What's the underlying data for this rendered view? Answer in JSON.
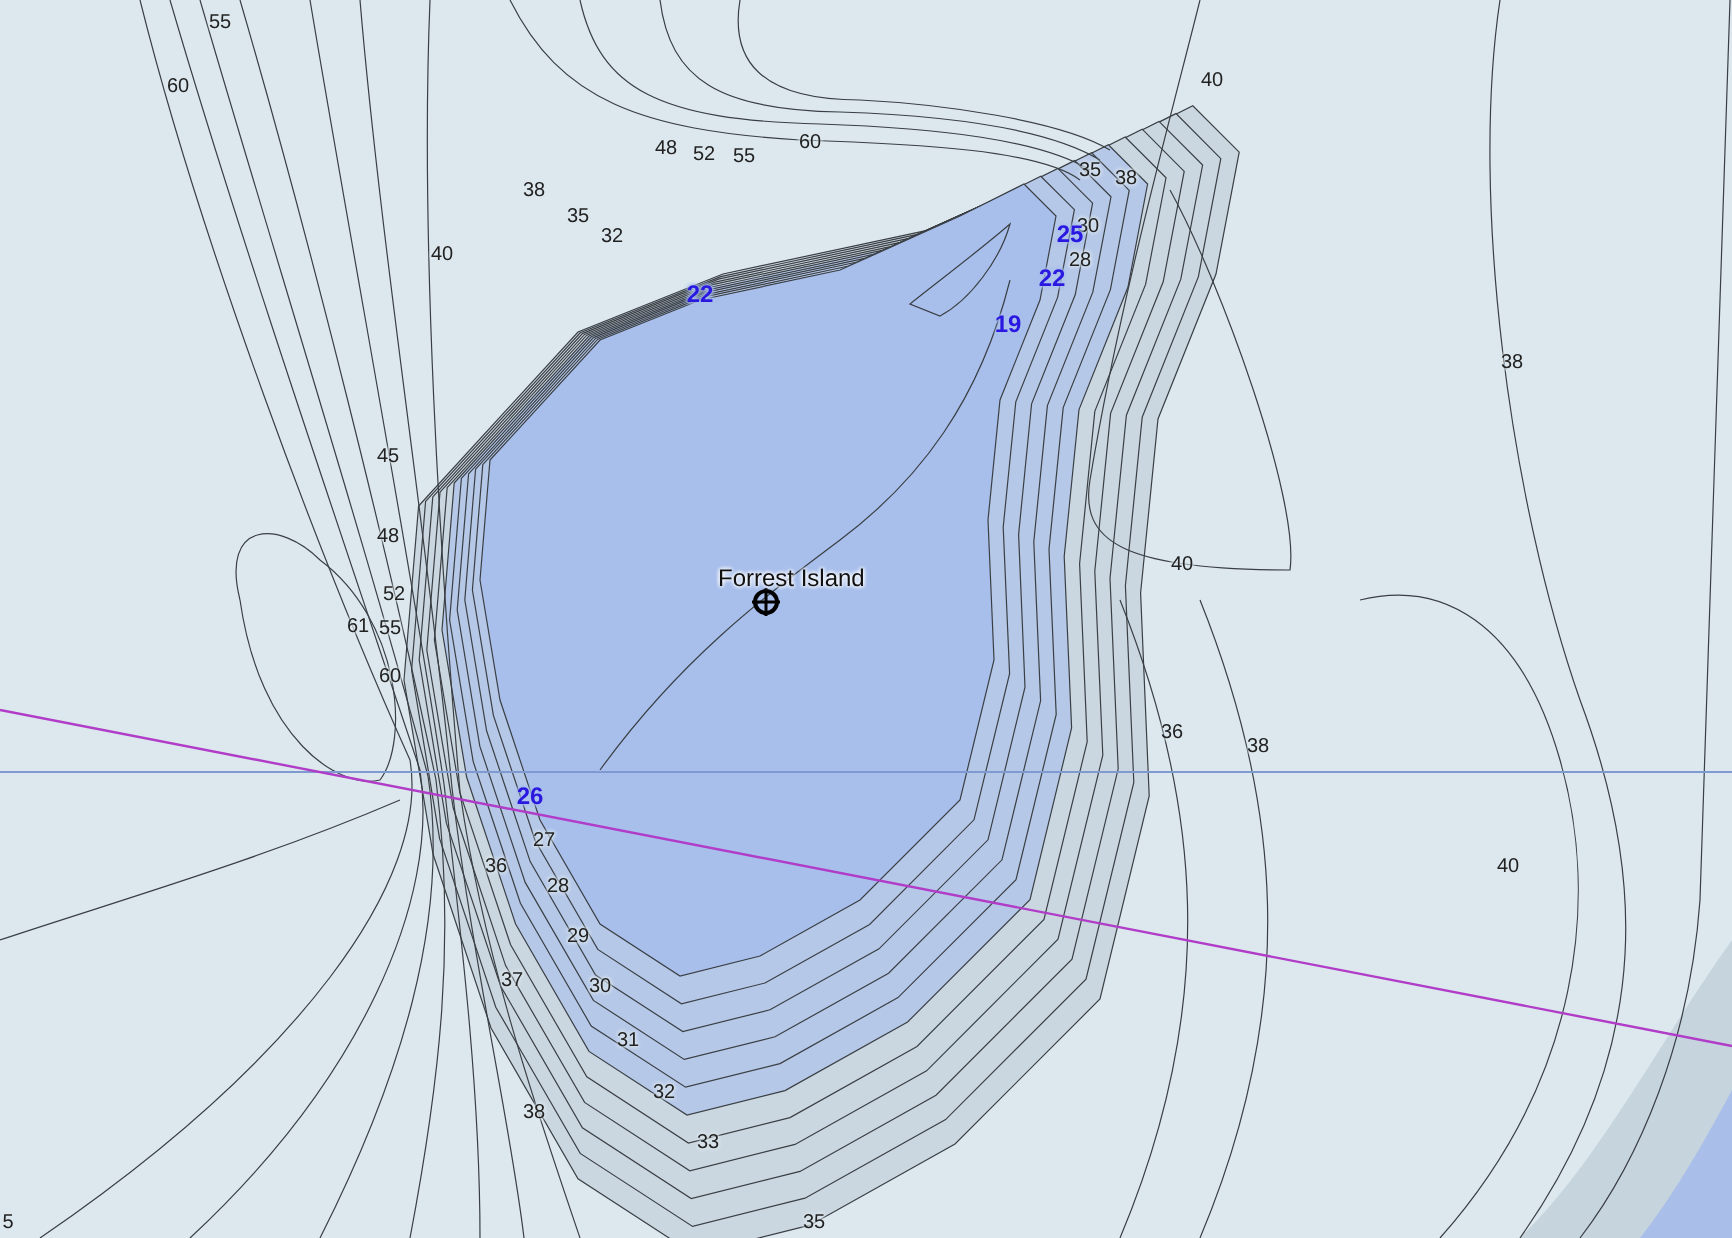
{
  "map": {
    "place": {
      "name": "Forrest Island"
    },
    "depth_labels": [
      {
        "text": "55",
        "kind": "contour"
      },
      {
        "text": "60",
        "kind": "contour"
      },
      {
        "text": "48",
        "kind": "contour"
      },
      {
        "text": "52",
        "kind": "contour"
      },
      {
        "text": "55",
        "kind": "contour"
      },
      {
        "text": "60",
        "kind": "contour"
      },
      {
        "text": "38",
        "kind": "contour"
      },
      {
        "text": "35",
        "kind": "contour"
      },
      {
        "text": "32",
        "kind": "contour"
      },
      {
        "text": "40",
        "kind": "contour"
      },
      {
        "text": "22",
        "kind": "sounding"
      },
      {
        "text": "45",
        "kind": "contour"
      },
      {
        "text": "48",
        "kind": "contour"
      },
      {
        "text": "52",
        "kind": "contour"
      },
      {
        "text": "61",
        "kind": "contour"
      },
      {
        "text": "55",
        "kind": "contour"
      },
      {
        "text": "60",
        "kind": "contour"
      },
      {
        "text": "40",
        "kind": "contour"
      },
      {
        "text": "35",
        "kind": "contour"
      },
      {
        "text": "38",
        "kind": "contour"
      },
      {
        "text": "30",
        "kind": "contour"
      },
      {
        "text": "25",
        "kind": "sounding"
      },
      {
        "text": "28",
        "kind": "contour"
      },
      {
        "text": "22",
        "kind": "sounding"
      },
      {
        "text": "19",
        "kind": "sounding"
      },
      {
        "text": "38",
        "kind": "contour"
      },
      {
        "text": "40",
        "kind": "contour"
      },
      {
        "text": "36",
        "kind": "contour"
      },
      {
        "text": "38",
        "kind": "contour"
      },
      {
        "text": "40",
        "kind": "contour"
      },
      {
        "text": "26",
        "kind": "sounding"
      },
      {
        "text": "27",
        "kind": "contour"
      },
      {
        "text": "36",
        "kind": "contour"
      },
      {
        "text": "28",
        "kind": "contour"
      },
      {
        "text": "29",
        "kind": "contour"
      },
      {
        "text": "37",
        "kind": "contour"
      },
      {
        "text": "30",
        "kind": "contour"
      },
      {
        "text": "31",
        "kind": "contour"
      },
      {
        "text": "32",
        "kind": "contour"
      },
      {
        "text": "38",
        "kind": "contour"
      },
      {
        "text": "33",
        "kind": "contour"
      },
      {
        "text": "5",
        "kind": "contour"
      },
      {
        "text": "35",
        "kind": "contour"
      }
    ]
  }
}
